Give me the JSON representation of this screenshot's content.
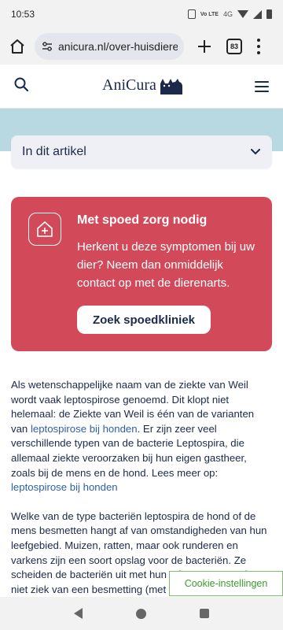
{
  "status_bar": {
    "time": "10:53",
    "lte_label": "Vo LTE",
    "network_label": "4G"
  },
  "browser": {
    "url": "anicura.nl/over-huisdieren",
    "tab_count": "83"
  },
  "site": {
    "logo_text": "AniCura"
  },
  "toc": {
    "label": "In dit artikel"
  },
  "urgent": {
    "title": "Met spoed zorg nodig",
    "text": "Herkent u deze symptomen bij uw dier? Neem dan onmiddelijk contact op met de dierenarts.",
    "button_label": "Zoek spoedkliniek"
  },
  "article": {
    "p1_a": "Als wetenschappelijke naam van de ziekte van Weil wordt vaak leptospirose genoemd. Dit klopt niet helemaal: de Ziekte van Weil is één van de varianten van ",
    "p1_link1": "leptospirose bij honden",
    "p1_b": ". Er zijn zeer veel verschillende typen van de bacterie Leptospira, die allemaal ziekte veroorzaken bij hun eigen gastheer, zoals bij de mens en de hond. Lees meer op: ",
    "p1_link2": "leptospirose bij honden",
    "p2": "Welke van de type bacteriën leptospira de hond of de mens besmetten hangt af van omstandigheden van hun leefgebied. Muizen, ratten, maar ook runderen en varkens zijn een soort opslag voor de bacteriën. Ze scheiden de bacteriën uit met hun urine, maar worden niet ziek van een besmetting (met uitzondering van koeien)."
  },
  "cookie": {
    "label": "Cookie-instellingen"
  },
  "colors": {
    "urgent_bg": "#d24a5a",
    "band": "#b9d9e2",
    "brand_text": "#1b2a4a",
    "link": "#2d5fa8",
    "cookie_green": "#3d9a2e"
  }
}
